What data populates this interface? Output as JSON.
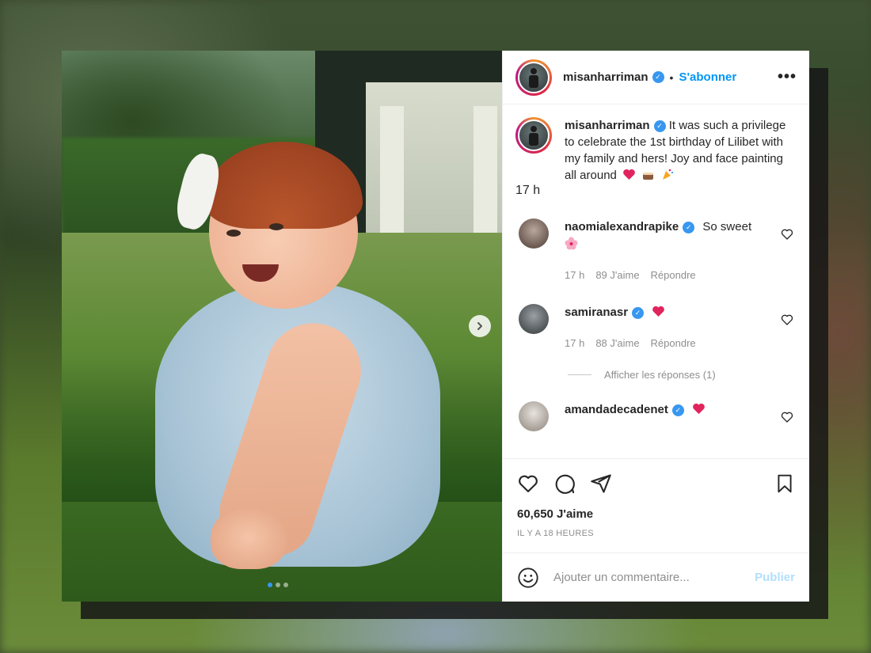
{
  "post": {
    "author": "misanharriman",
    "follow_label": "S'abonner",
    "separator": "•",
    "more_label": "•••",
    "caption": {
      "author": "misanharriman",
      "text": "It was such a privilege to celebrate the 1st birthday of Lilibet with my family and hers! Joy and face painting all around",
      "time": "17 h"
    },
    "comments": [
      {
        "author": "naomialexandrapike",
        "text": "So sweet",
        "time": "17 h",
        "likes": "89 J'aime",
        "reply": "Répondre"
      },
      {
        "author": "samiranasr",
        "text": "",
        "time": "17 h",
        "likes": "88 J'aime",
        "reply": "Répondre"
      },
      {
        "author": "amandadecadenet",
        "text": ""
      }
    ],
    "view_replies": "Afficher les réponses (1)",
    "likes_count": "60,650 J'aime",
    "posted_ago": "IL Y A 18 HEURES",
    "comment_input": {
      "placeholder": "Ajouter un commentaire...",
      "publish_label": "Publier"
    },
    "carousel": {
      "current": 1,
      "total": 3
    }
  },
  "colors": {
    "accent": "#0095f6",
    "verified": "#3897f0",
    "heart_red": "#ed4956",
    "muted": "#8e8e8e"
  },
  "icons": [
    "heart-icon",
    "comment-icon",
    "share-icon",
    "bookmark-icon",
    "emoji-icon",
    "verified-badge-icon",
    "chevron-right-icon",
    "more-icon"
  ]
}
